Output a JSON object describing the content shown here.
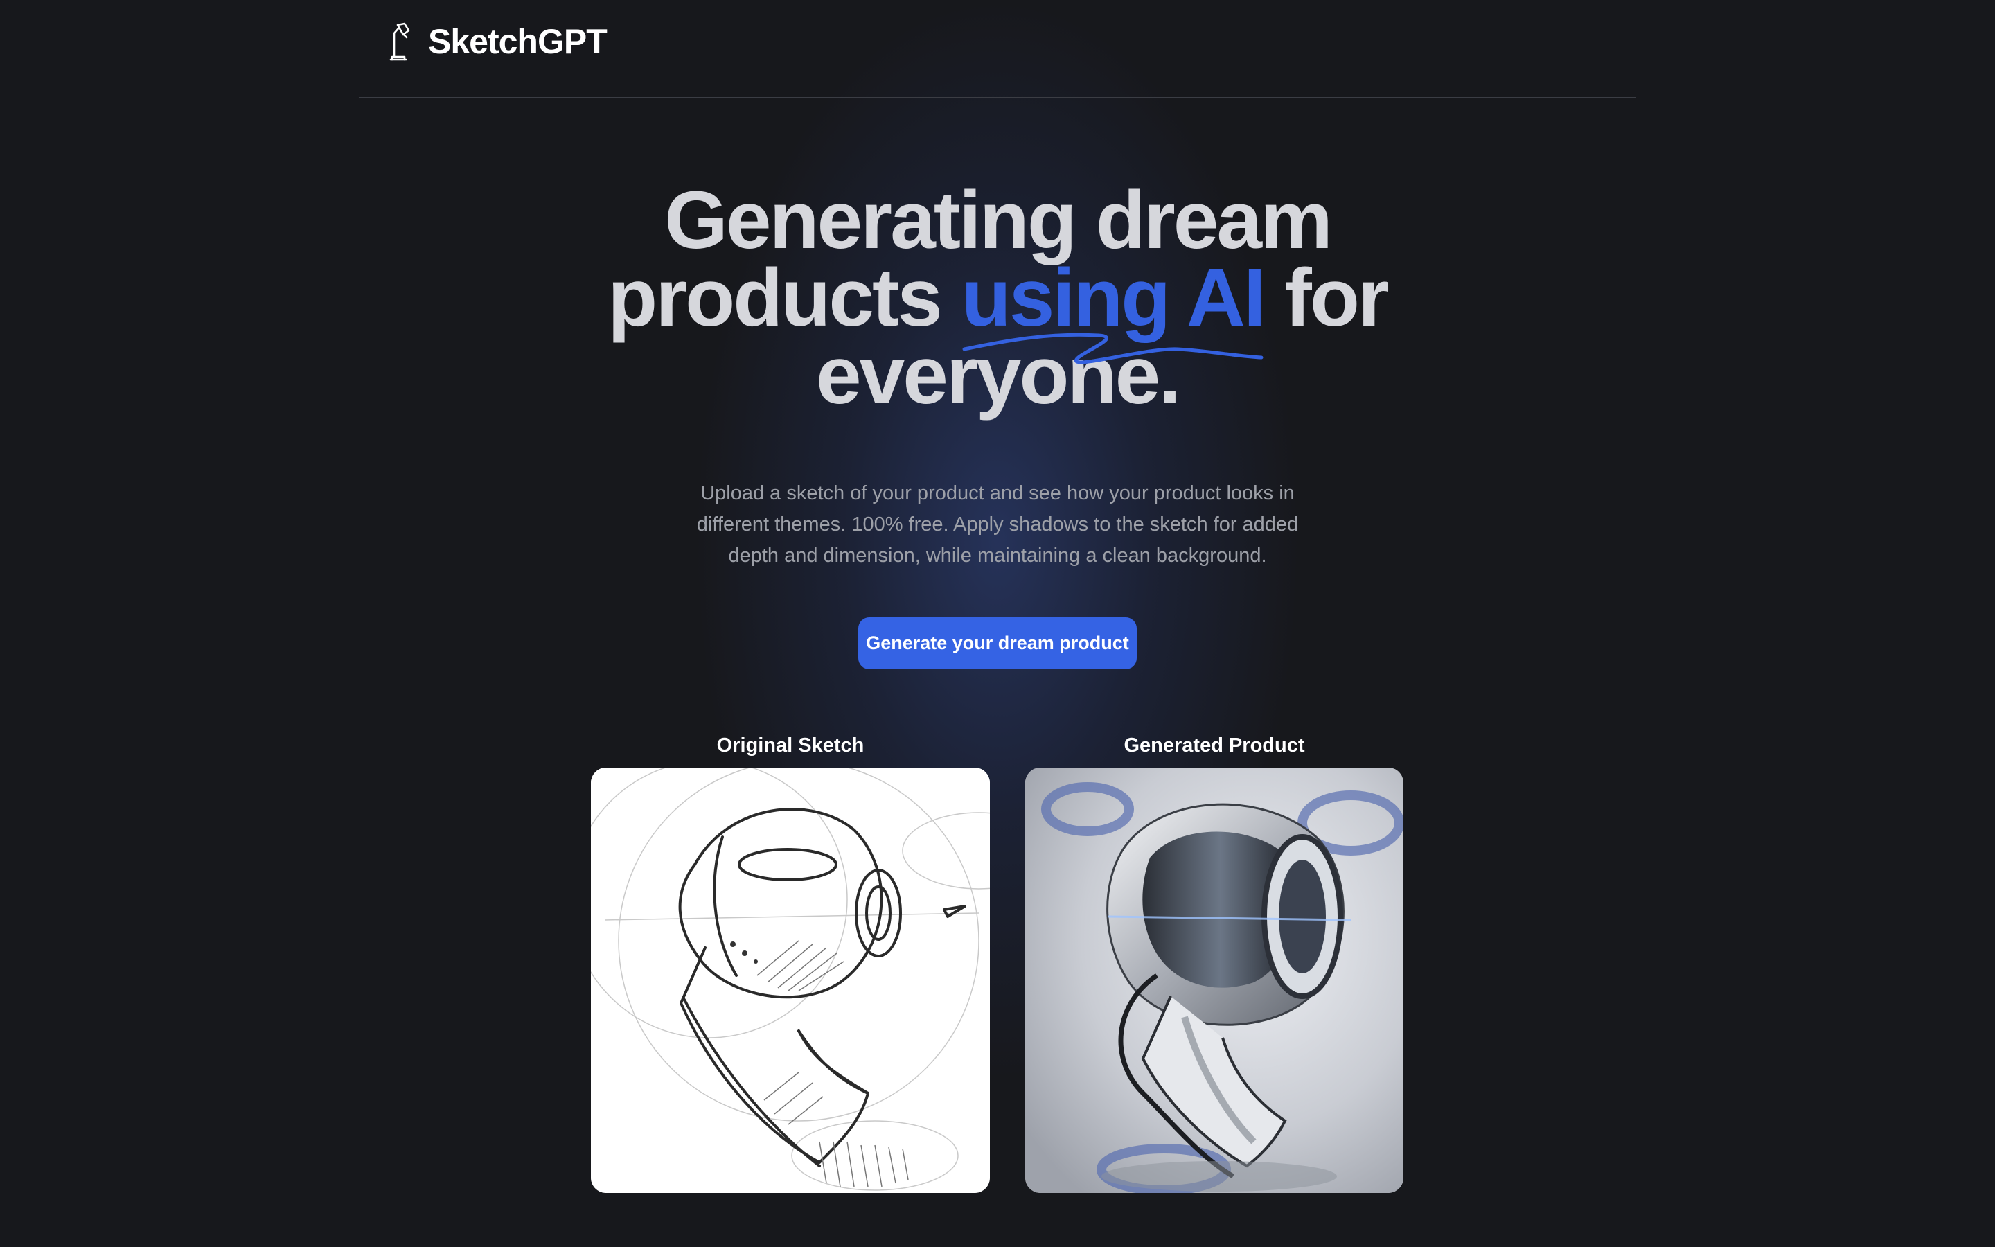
{
  "header": {
    "brand": "SketchGPT",
    "logo_icon": "desk-lamp-icon"
  },
  "hero": {
    "title_before": "Generating dream products ",
    "title_accent": "using AI",
    "title_after": " for everyone.",
    "subtitle": "Upload a sketch of your product and see how your product looks in different themes. 100% free. Apply shadows to the sketch for added depth and dimension, while maintaining a clean background.",
    "cta_label": "Generate your dream product"
  },
  "showcase": {
    "original_label": "Original Sketch",
    "generated_label": "Generated Product"
  },
  "colors": {
    "background": "#17181c",
    "accent": "#3563e4",
    "title": "#d6d7dc",
    "subtitle": "#9da0a8"
  }
}
